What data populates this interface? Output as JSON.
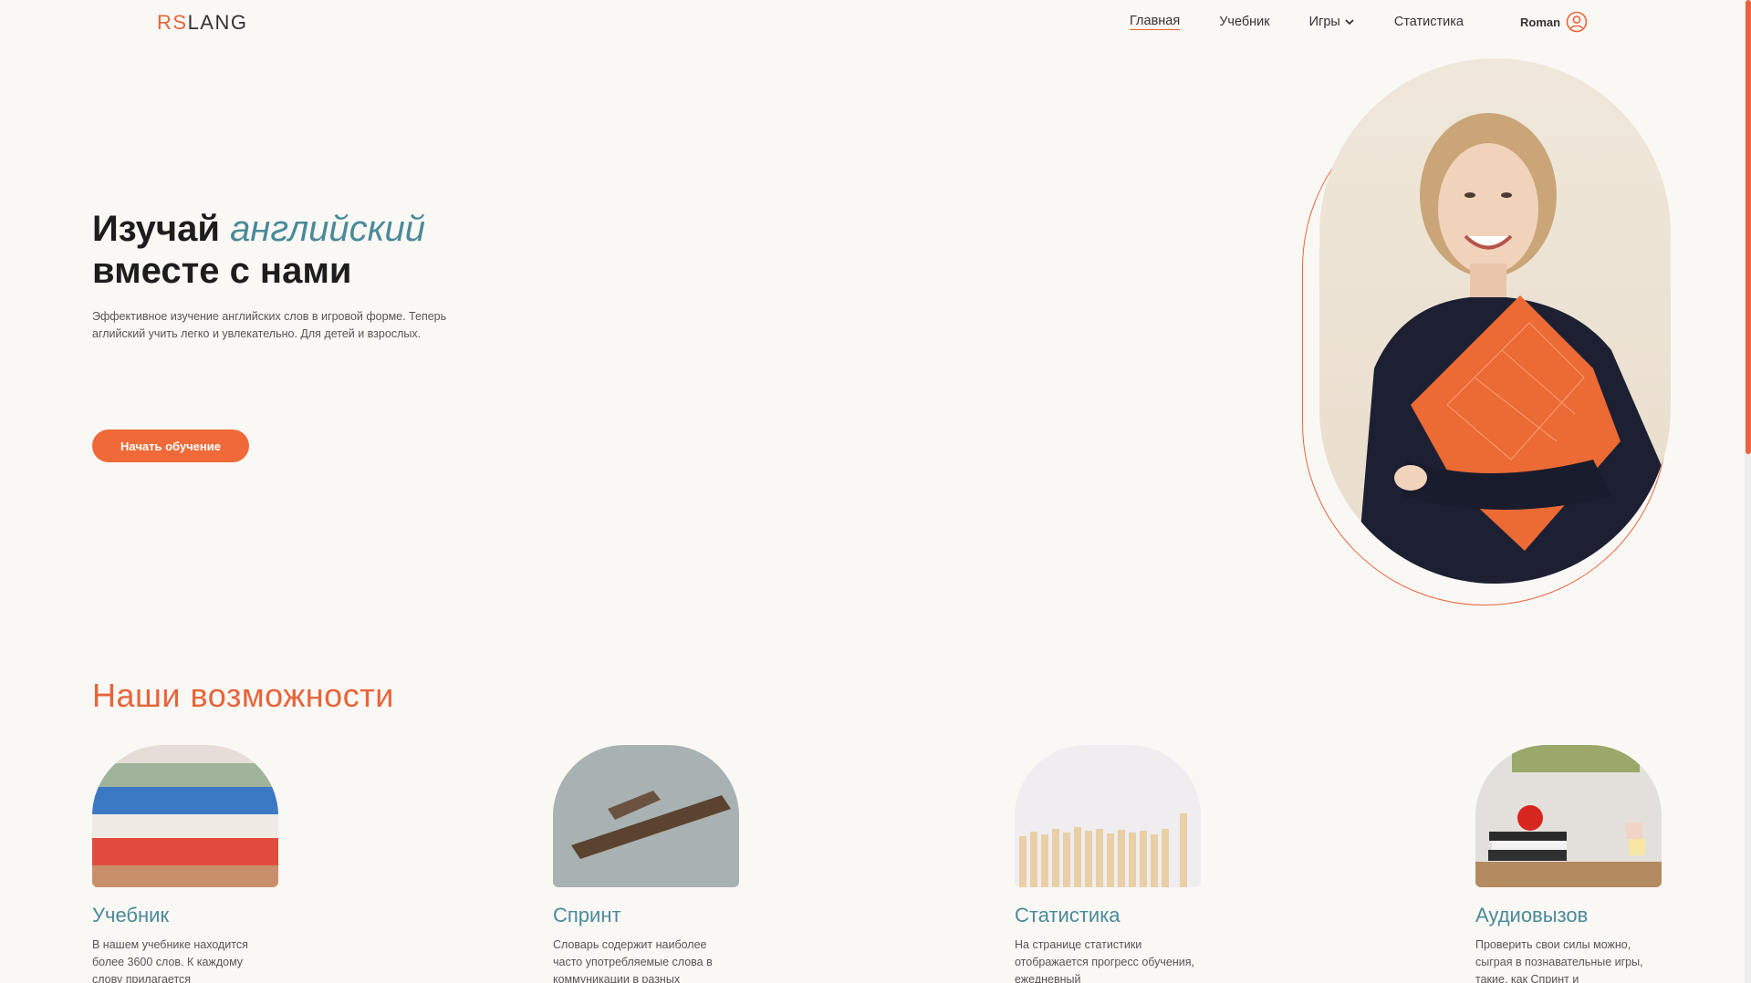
{
  "header": {
    "logo_accent": "RS",
    "logo_rest": "LANG",
    "nav": [
      {
        "label": "Главная",
        "active": true
      },
      {
        "label": "Учебник"
      },
      {
        "label": "Игры"
      },
      {
        "label": "Статистика"
      }
    ],
    "user_name": "Roman"
  },
  "hero": {
    "title_line1_start": "Изучай ",
    "title_line1_accent": "английский",
    "title_line2": "вместе с нами",
    "description": "Эффективное изучение английских слов в игровой форме. Теперь аглийский учить легко и увлекательно. Для детей и взрослых.",
    "cta_label": "Начать обучение"
  },
  "features": {
    "title": "Наши возможности",
    "cards": [
      {
        "title": "Учебник",
        "text": "В нашем учебнике находится более 3600 слов. К каждому слову прилагается"
      },
      {
        "title": "Спринт",
        "text": "Словарь содержит наиболее часто употребляемые слова в коммуникации в разных"
      },
      {
        "title": "Статистика",
        "text": "На странице статистики отображается прогресс обучения, ежедневный"
      },
      {
        "title": "Аудиовызов",
        "text": "Проверить свои силы можно, сыграя в познавательные игры, такие, как Спринт и"
      }
    ]
  },
  "colors": {
    "accent": "#e8643a",
    "teal": "#4a8a99",
    "background": "#faf8f5"
  }
}
